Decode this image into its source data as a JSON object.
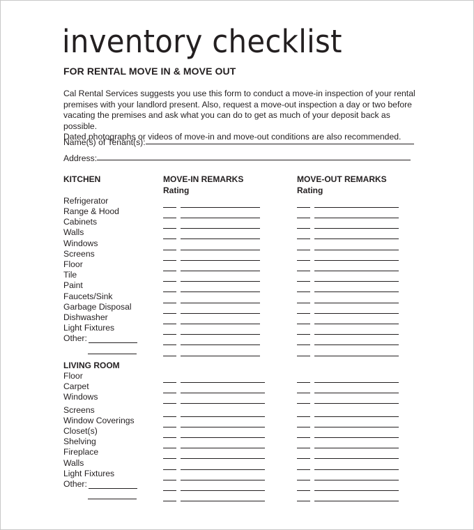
{
  "document": {
    "title": "inventory checklist",
    "subtitle": "FOR RENTAL MOVE IN & MOVE OUT",
    "intro_lines": [
      "Cal Rental Services suggests you use this form to conduct a move-in inspection of your rental",
      "premises with your landlord present.  Also, request a move-out inspection a day or two before",
      "vacating the premises and ask what you can do to get as much of your deposit back as possible.",
      "Dated photographs or videos of move-in and move-out conditions are also recommended."
    ],
    "fields": {
      "tenants_label": "Name(s) of Tenant(s):",
      "tenants_value": "",
      "address_label": "Address:",
      "address_value": ""
    },
    "columns": {
      "move_in": "MOVE-IN REMARKS",
      "move_out": "MOVE-OUT REMARKS",
      "rating": "Rating"
    },
    "sections": [
      {
        "name": "KITCHEN",
        "items": [
          "Refrigerator",
          "Range & Hood",
          "Cabinets",
          "Walls",
          "Windows",
          "Screens",
          "Floor",
          "Tile",
          "Paint",
          "Faucets/Sink",
          "Garbage Disposal",
          "Dishwasher",
          "Light Fixtures",
          "Other:",
          ""
        ]
      },
      {
        "name": "LIVING ROOM",
        "items": [
          "Floor",
          "Carpet",
          "Windows",
          "Screens",
          "Window Coverings",
          "Closet(s)",
          "Shelving",
          "Fireplace",
          "Walls",
          "Light Fixtures",
          "Other:",
          ""
        ]
      }
    ]
  }
}
